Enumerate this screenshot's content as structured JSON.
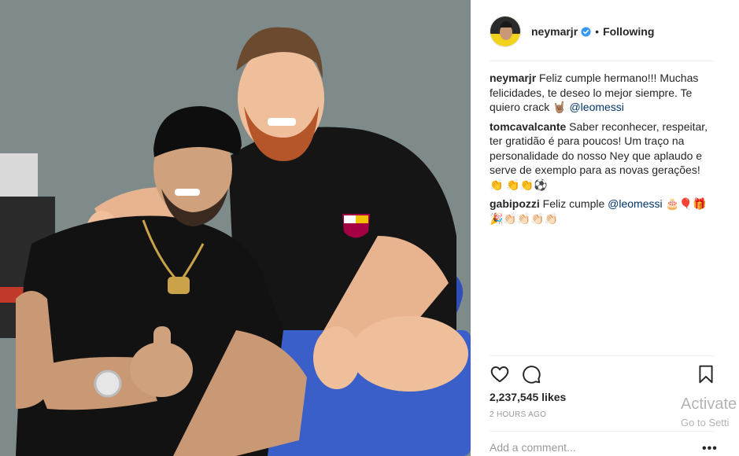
{
  "post": {
    "username": "neymarjr",
    "verified_icon": "verified-badge-icon",
    "dot": "•",
    "follow_status": "Following",
    "likes": "2,237,545 likes",
    "timestamp": "2 HOURS AGO",
    "add_comment_placeholder": "Add a comment...",
    "more_options": "•••"
  },
  "comments": [
    {
      "user": "neymarjr",
      "text": "Feliz cumple hermano!!! Muchas felicidades, te deseo lo mejor siempre. Te quiero crack 🤘🏽",
      "mention": "@leomessi",
      "after": ""
    },
    {
      "user": "tomcavalcante",
      "text": "Saber reconhecer, respeitar, ter gratidão é para poucos! Um traço na personalidade do nosso Ney que aplaudo e serve de exemplo para as novas gerações! 👏 👏👏⚽",
      "mention": "",
      "after": ""
    },
    {
      "user": "gabipozzi",
      "text": "Feliz cumple",
      "mention": "@leomessi",
      "after": "🎂🎈🎁 🎉👏🏻👏🏻👏🏻👏🏻"
    }
  ],
  "icons": {
    "like": "heart-icon",
    "comment": "comment-bubble-icon",
    "save": "bookmark-icon"
  },
  "colors": {
    "text": "#262626",
    "mention": "#003569",
    "muted": "#999999",
    "verified": "#3897f0",
    "divider": "#efefef"
  },
  "watermark": {
    "line1": "Activate",
    "line2": "Go to Setti"
  }
}
